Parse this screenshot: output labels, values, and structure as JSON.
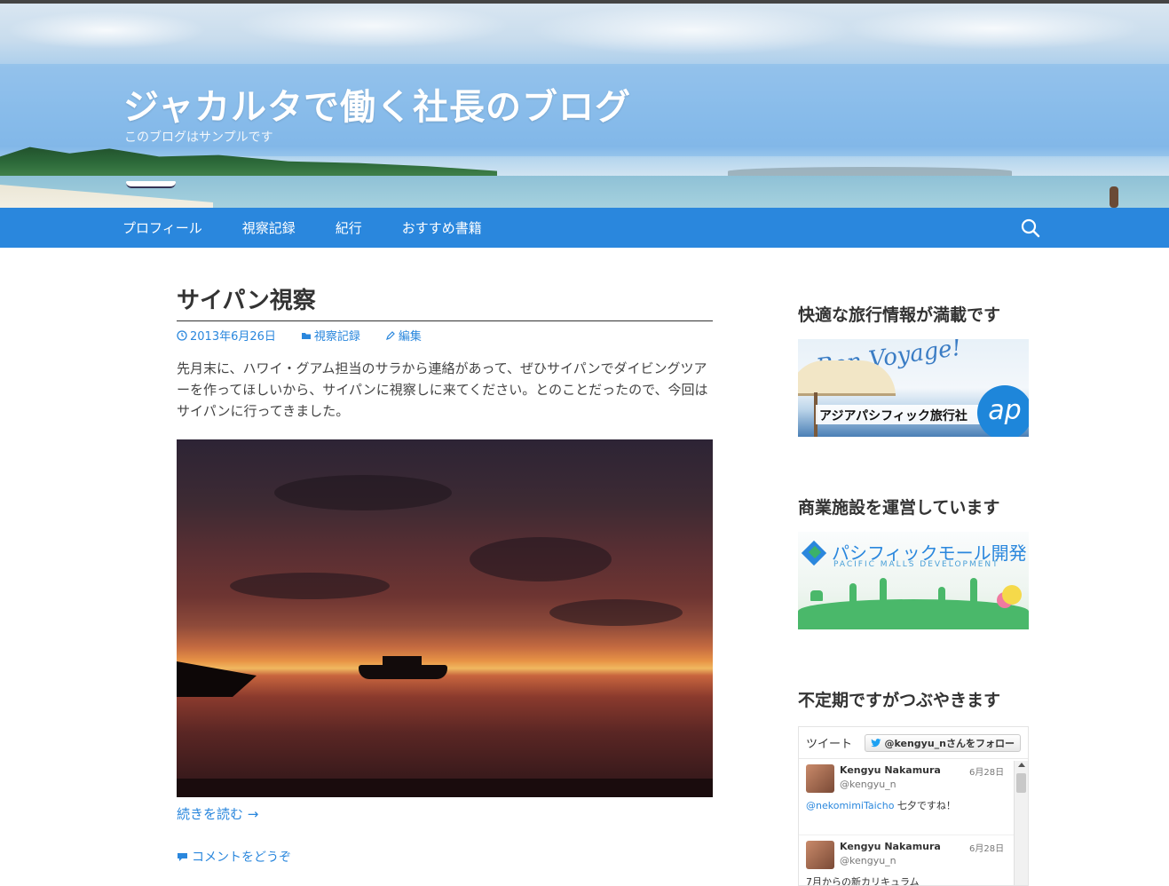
{
  "site": {
    "title": "ジャカルタで働く社長のブログ",
    "description": "このブログはサンプルです"
  },
  "nav": {
    "items": [
      "プロフィール",
      "視察記録",
      "紀行",
      "おすすめ書籍"
    ],
    "search_icon": "search-icon"
  },
  "post": {
    "title": "サイパン視察",
    "date": "2013年6月26日",
    "category": "視察記録",
    "edit": "編集",
    "excerpt": "先月末に、ハワイ・グアム担当のサラから連絡があって、ぜひサイパンでダイビングツアーを作ってほしいから、サイパンに視察しに来てください。とのことだったので、今回はサイパンに行ってきました。",
    "read_more": "続きを読む →",
    "comments": "コメントをどうぞ"
  },
  "sidebar": {
    "widget1": {
      "title": "快適な旅行情報が満載です",
      "banner_script": "Bon Voyage!",
      "banner_label": "アジアパシフィック旅行社",
      "banner_logo": "ap"
    },
    "widget2": {
      "title": "商業施設を運営しています",
      "banner_title": "パシフィックモール開発",
      "banner_sub": "PACIFIC MALLS DEVELOPMENT"
    },
    "widget3": {
      "title": "不定期ですがつぶやきます",
      "twitter": {
        "header": "ツイート",
        "follow": "@kengyu_nさんをフォロー",
        "tweets": [
          {
            "name": "Kengyu Nakamura",
            "handle": "@kengyu_n",
            "date": "6月28日",
            "mention": "@nekomimiTaicho",
            "text": " 七夕ですね！"
          },
          {
            "name": "Kengyu Nakamura",
            "handle": "@kengyu_n",
            "date": "6月28日",
            "mention": "",
            "text": "7月からの新カリキュラム"
          }
        ]
      }
    }
  },
  "colors": {
    "accent": "#2a87dd",
    "nav_bg": "#2a87dd",
    "text": "#333333"
  }
}
